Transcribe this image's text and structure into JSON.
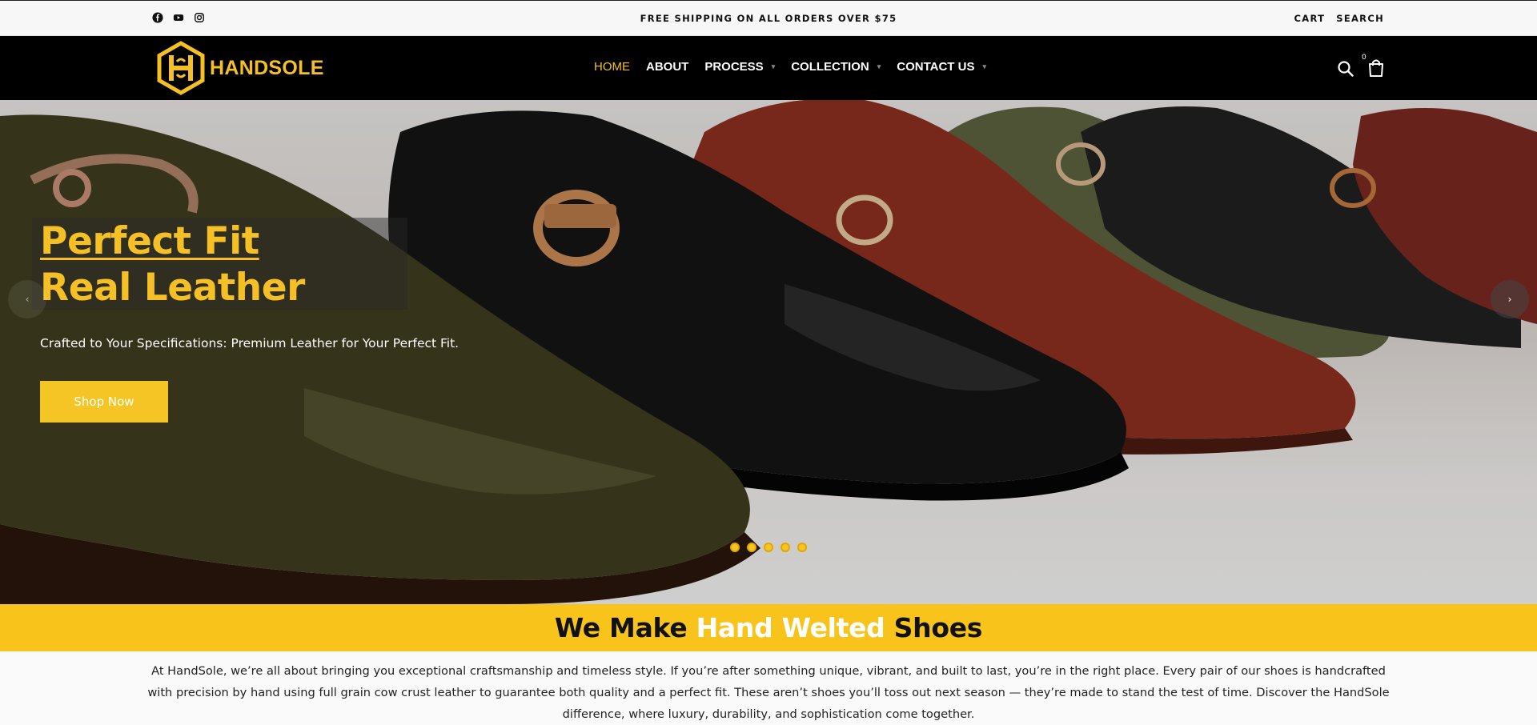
{
  "topbar": {
    "socials": [
      "facebook-icon",
      "youtube-icon",
      "instagram-icon"
    ],
    "announcement": "FREE SHIPPING ON ALL ORDERS OVER $75",
    "links": {
      "cart": "CART",
      "search": "SEARCH"
    }
  },
  "header": {
    "logo_text": "HANDSOLE",
    "nav": [
      {
        "label": "HOME",
        "active": true,
        "has_dropdown": false
      },
      {
        "label": "ABOUT",
        "active": false,
        "has_dropdown": false
      },
      {
        "label": "PROCESS",
        "active": false,
        "has_dropdown": true
      },
      {
        "label": "COLLECTION",
        "active": false,
        "has_dropdown": true
      },
      {
        "label": "CONTACT US",
        "active": false,
        "has_dropdown": true
      }
    ],
    "cart_count": "0",
    "icons": [
      "search-icon",
      "shopping-bag-icon"
    ]
  },
  "hero": {
    "headline_line1": "Perfect Fit",
    "headline_line2": "Real Leather",
    "subheadline": "Crafted to Your Specifications: Premium Leather for Your Perfect Fit.",
    "button_label": "Shop Now",
    "prev_arrow": "‹",
    "next_arrow": "›",
    "slide_count": 5
  },
  "band": {
    "part1": "We Make ",
    "highlight": "Hand Welted",
    "part2": " Shoes"
  },
  "intro": {
    "text": "At HandSole, we’re all about bringing you exceptional craftsmanship and timeless style. If you’re after something unique, vibrant, and built to last, you’re in the right place. Every pair of our shoes is handcrafted with precision by hand using full grain cow crust leather to guarantee both quality and a perfect fit. These aren’t shoes you’ll toss out next season — they’re made to stand the test of time. Discover the HandSole difference, where luxury, durability, and sophistication come together."
  },
  "colors": {
    "brand_yellow": "#f5c025",
    "header_bg": "#000000",
    "band_bg": "#f8c41c"
  }
}
